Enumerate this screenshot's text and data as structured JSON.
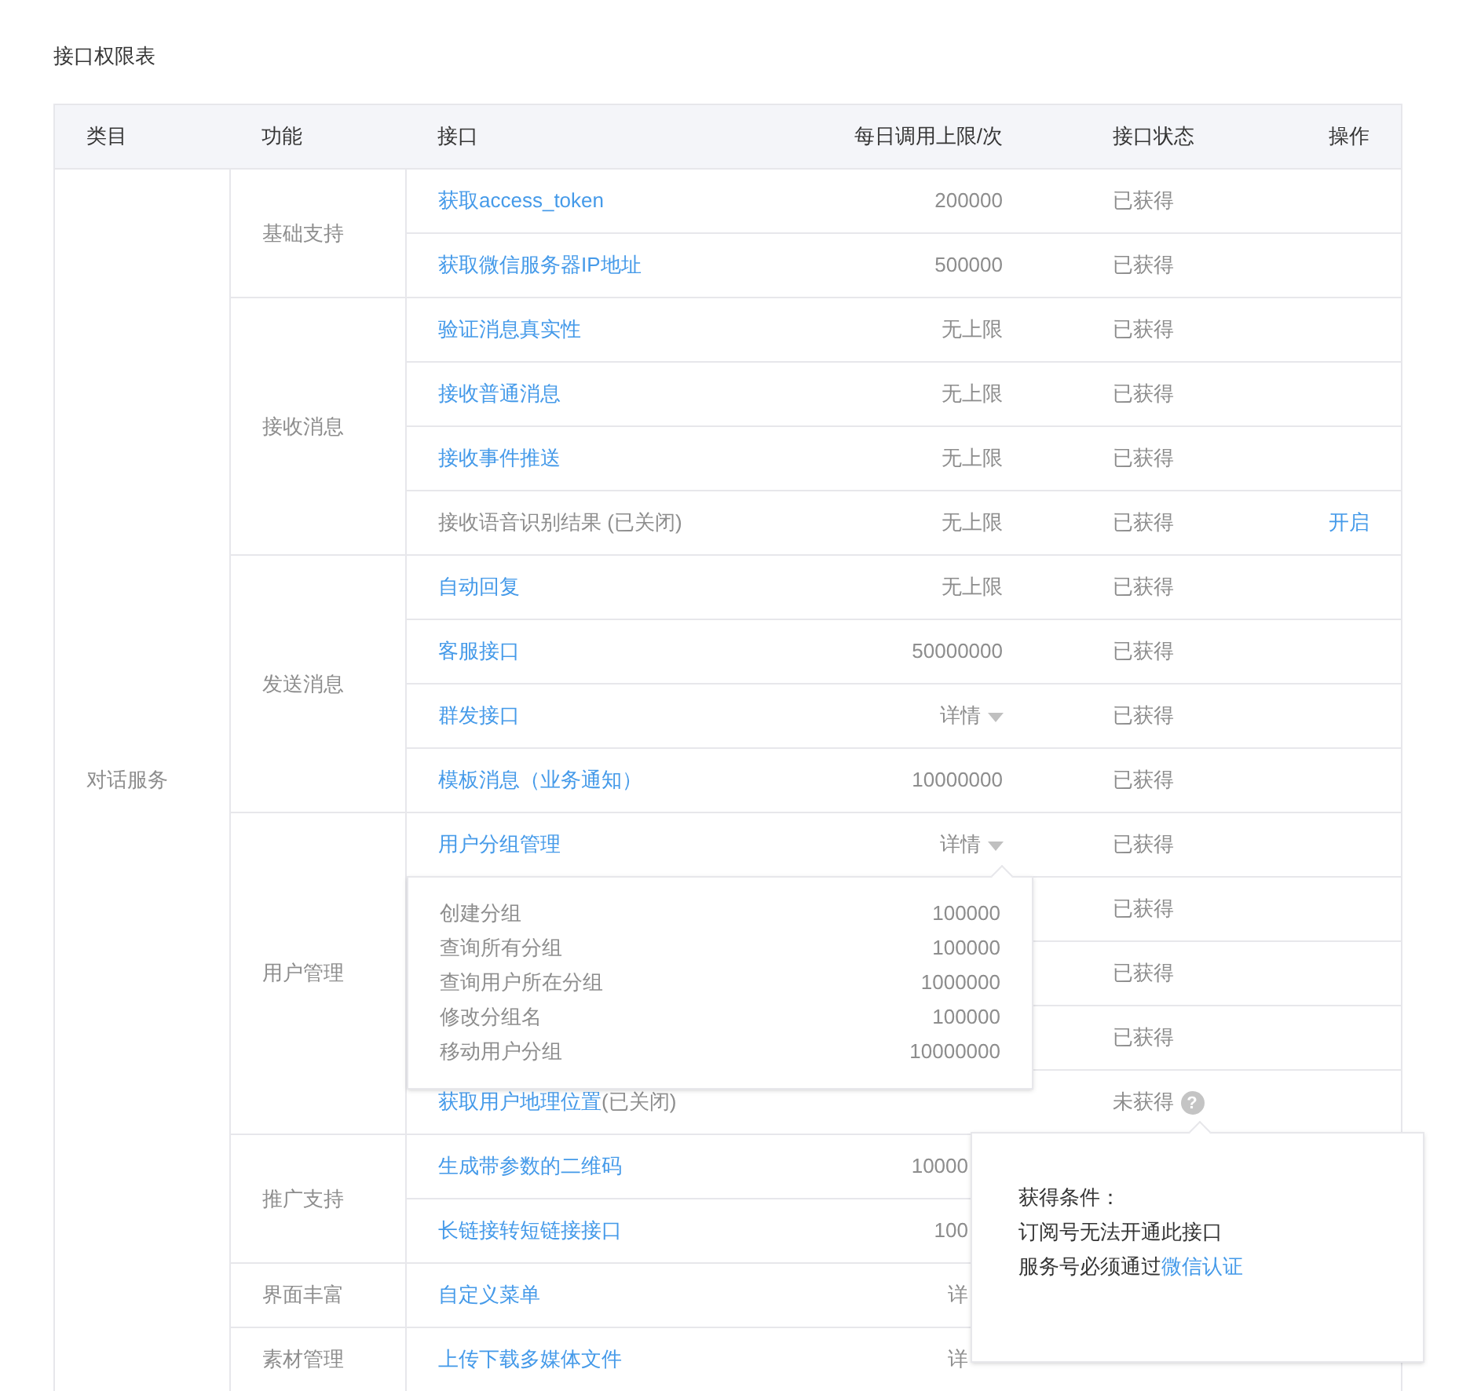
{
  "title": "接口权限表",
  "columns": [
    "类目",
    "功能",
    "接口",
    "每日调用上限/次",
    "接口状态",
    "操作"
  ],
  "categories": [
    {
      "name": "对话服务",
      "groups": [
        {
          "name": "基础支持",
          "rows": [
            {
              "name": "获取access_token",
              "link": true,
              "limit": "200000",
              "status": "已获得"
            },
            {
              "name": "获取微信服务器IP地址",
              "link": true,
              "limit": "500000",
              "status": "已获得"
            }
          ]
        },
        {
          "name": "接收消息",
          "rows": [
            {
              "name": "验证消息真实性",
              "link": true,
              "limit": "无上限",
              "status": "已获得"
            },
            {
              "name": "接收普通消息",
              "link": true,
              "limit": "无上限",
              "status": "已获得"
            },
            {
              "name": "接收事件推送",
              "link": true,
              "limit": "无上限",
              "status": "已获得"
            },
            {
              "name": "接收语音识别结果 (已关闭)",
              "link": false,
              "limit": "无上限",
              "status": "已获得",
              "action": "开启"
            }
          ]
        },
        {
          "name": "发送消息",
          "rows": [
            {
              "name": "自动回复",
              "link": true,
              "limit": "无上限",
              "status": "已获得"
            },
            {
              "name": "客服接口",
              "link": true,
              "limit": "50000000",
              "status": "已获得"
            },
            {
              "name": "群发接口",
              "link": true,
              "limit": "详情",
              "kind": "details",
              "status": "已获得"
            },
            {
              "name": "模板消息（业务通知）",
              "link": true,
              "limit": "10000000",
              "status": "已获得"
            }
          ]
        },
        {
          "name": "用户管理",
          "rows": [
            {
              "name": "用户分组管理",
              "link": true,
              "limit": "详情",
              "kind": "details",
              "status": "已获得",
              "details": {
                "shown": true,
                "items": [
                  {
                    "name": "创建分组",
                    "limit": "100000"
                  },
                  {
                    "name": "查询所有分组",
                    "limit": "100000"
                  },
                  {
                    "name": "查询用户所在分组",
                    "limit": "1000000"
                  },
                  {
                    "name": "修改分组名",
                    "limit": "100000"
                  },
                  {
                    "name": "移动用户分组",
                    "limit": "10000000"
                  }
                ]
              }
            },
            {
              "status": "已获得"
            },
            {
              "status": "已获得"
            },
            {
              "status": "已获得"
            },
            {
              "name": "获取用户地理位置",
              "note": "(已关闭)",
              "link": true,
              "status": "未获得",
              "help": {
                "icon": "?",
                "shown": true,
                "title": "获得条件：",
                "line": "订阅号无法开通此接口",
                "prefix": "服务号必须通过",
                "link": "微信认证"
              }
            }
          ]
        },
        {
          "name": "推广支持",
          "rows": [
            {
              "name": "生成带参数的二维码",
              "link": true,
              "limit": "10000"
            },
            {
              "name": "长链接转短链接接口",
              "link": true,
              "limit": "100"
            }
          ]
        },
        {
          "name": "界面丰富",
          "rows": [
            {
              "name": "自定义菜单",
              "link": true,
              "limit": "详"
            }
          ]
        },
        {
          "name": "素材管理",
          "rows": [
            {
              "name": "上传下载多媒体文件",
              "link": true,
              "limit": "详"
            }
          ]
        }
      ]
    }
  ]
}
